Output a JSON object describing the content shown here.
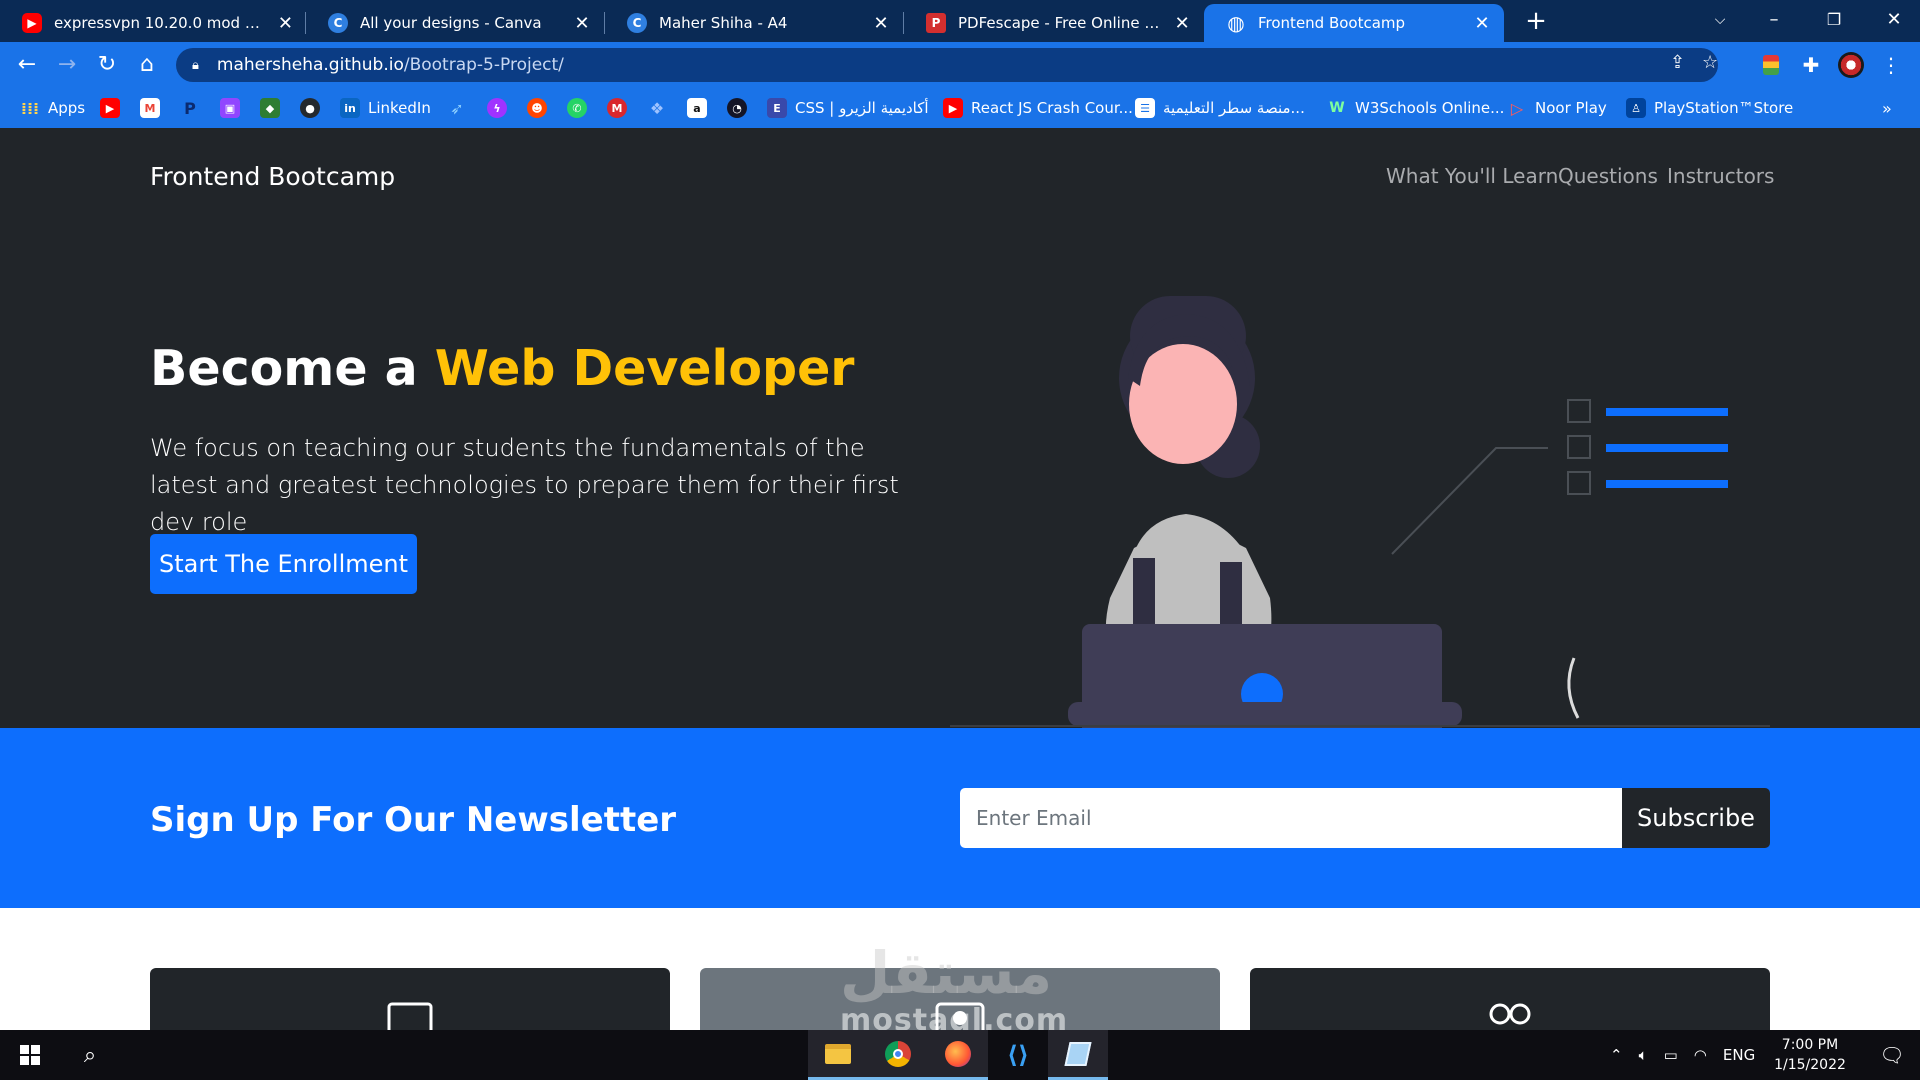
{
  "browser": {
    "tabs": [
      {
        "title": "expressvpn 10.20.0 mod apk - YouTube",
        "icon": "youtube-icon",
        "color": "#ff0000",
        "glyph": "▶"
      },
      {
        "title": "All your designs - Canva",
        "icon": "canva-icon",
        "color": "#2f7fe0",
        "glyph": "C"
      },
      {
        "title": "Maher Shiha - A4",
        "icon": "canva-icon",
        "color": "#2f7fe0",
        "glyph": "C"
      },
      {
        "title": "PDFescape - Free Online PDF Editor",
        "icon": "pdfescape-icon",
        "color": "#d32f2f",
        "glyph": "P"
      },
      {
        "title": "Frontend Bootcamp",
        "icon": "globe-icon",
        "color": "#ffffff",
        "glyph": "◍"
      }
    ],
    "url_host": "mahersheha.github.io",
    "url_path": "/Bootrap-5-Project/",
    "bookmarks": [
      {
        "label": "Apps",
        "icon": "apps-grid-icon",
        "color": "#e8453c"
      },
      {
        "label": "",
        "icon": "youtube-icon",
        "color": "#ff0000"
      },
      {
        "label": "",
        "icon": "gmail-icon",
        "color": "#ea4335"
      },
      {
        "label": "",
        "icon": "paypal-icon",
        "color": "#003087"
      },
      {
        "label": "",
        "icon": "twitch-icon",
        "color": "#9146ff"
      },
      {
        "label": "",
        "icon": "bookmark-icon",
        "color": "#2e7d32"
      },
      {
        "label": "",
        "icon": "github-icon",
        "color": "#24292e"
      },
      {
        "label": "LinkedIn",
        "icon": "linkedin-icon",
        "color": "#0a66c2"
      },
      {
        "label": "",
        "icon": "twitter-icon",
        "color": "#1da1f2"
      },
      {
        "label": "",
        "icon": "messenger-icon",
        "color": "#a033ff"
      },
      {
        "label": "",
        "icon": "reddit-icon",
        "color": "#ff4500"
      },
      {
        "label": "",
        "icon": "whatsapp-icon",
        "color": "#25d366"
      },
      {
        "label": "",
        "icon": "mega-icon",
        "color": "#d9272e"
      },
      {
        "label": "",
        "icon": "dropbox-icon",
        "color": "#0061ff"
      },
      {
        "label": "",
        "icon": "amazon-icon",
        "color": "#ffffff"
      },
      {
        "label": "",
        "icon": "speedtest-icon",
        "color": "#141526"
      },
      {
        "label": "CSS | أكاديمية الزيرو",
        "icon": "elzero-icon",
        "color": "#3949ab"
      },
      {
        "label": "React JS Crash Cour...",
        "icon": "youtube-icon",
        "color": "#ff0000"
      },
      {
        "label": "منصة سطر التعليمية...",
        "icon": "satr-icon",
        "color": "#ffffff"
      },
      {
        "label": "W3Schools Online...",
        "icon": "w3schools-icon",
        "color": "#04aa6d"
      },
      {
        "label": "Noor Play",
        "icon": "noorplay-icon",
        "color": "#e53935"
      },
      {
        "label": "PlayStation™Store",
        "icon": "playstation-icon",
        "color": "#00439c"
      }
    ]
  },
  "site": {
    "brand": "Frontend Bootcamp",
    "nav": [
      "What You'll Learn",
      "Questions",
      "Instructors"
    ],
    "hero": {
      "title_prefix": "Become a",
      "title_accent": "Web Developer",
      "lead": "We focus on teaching our students the fundamentals of the latest and greatest technologies to prepare them for their first dev role",
      "cta": "Start The Enrollment"
    },
    "newsletter": {
      "title": "Sign Up For Our Newsletter",
      "placeholder": "Enter Email",
      "button": "Subscribe"
    },
    "cards": [
      {
        "icon": "laptop-icon"
      },
      {
        "icon": "person-badge-icon"
      },
      {
        "icon": "people-icon"
      }
    ]
  },
  "watermark": {
    "arabic": "مستقل",
    "latin": "mostaql.com"
  },
  "taskbar": {
    "apps": [
      "file-explorer-icon",
      "chrome-icon",
      "firefox-icon",
      "vscode-icon",
      "notepad-icon"
    ],
    "language": "ENG",
    "time": "7:00 PM",
    "date": "1/15/2022"
  },
  "colors": {
    "hero_bg": "#212529",
    "accent": "#ffc107",
    "primary": "#0d6efd",
    "browser_frame": "#1a73e8"
  }
}
